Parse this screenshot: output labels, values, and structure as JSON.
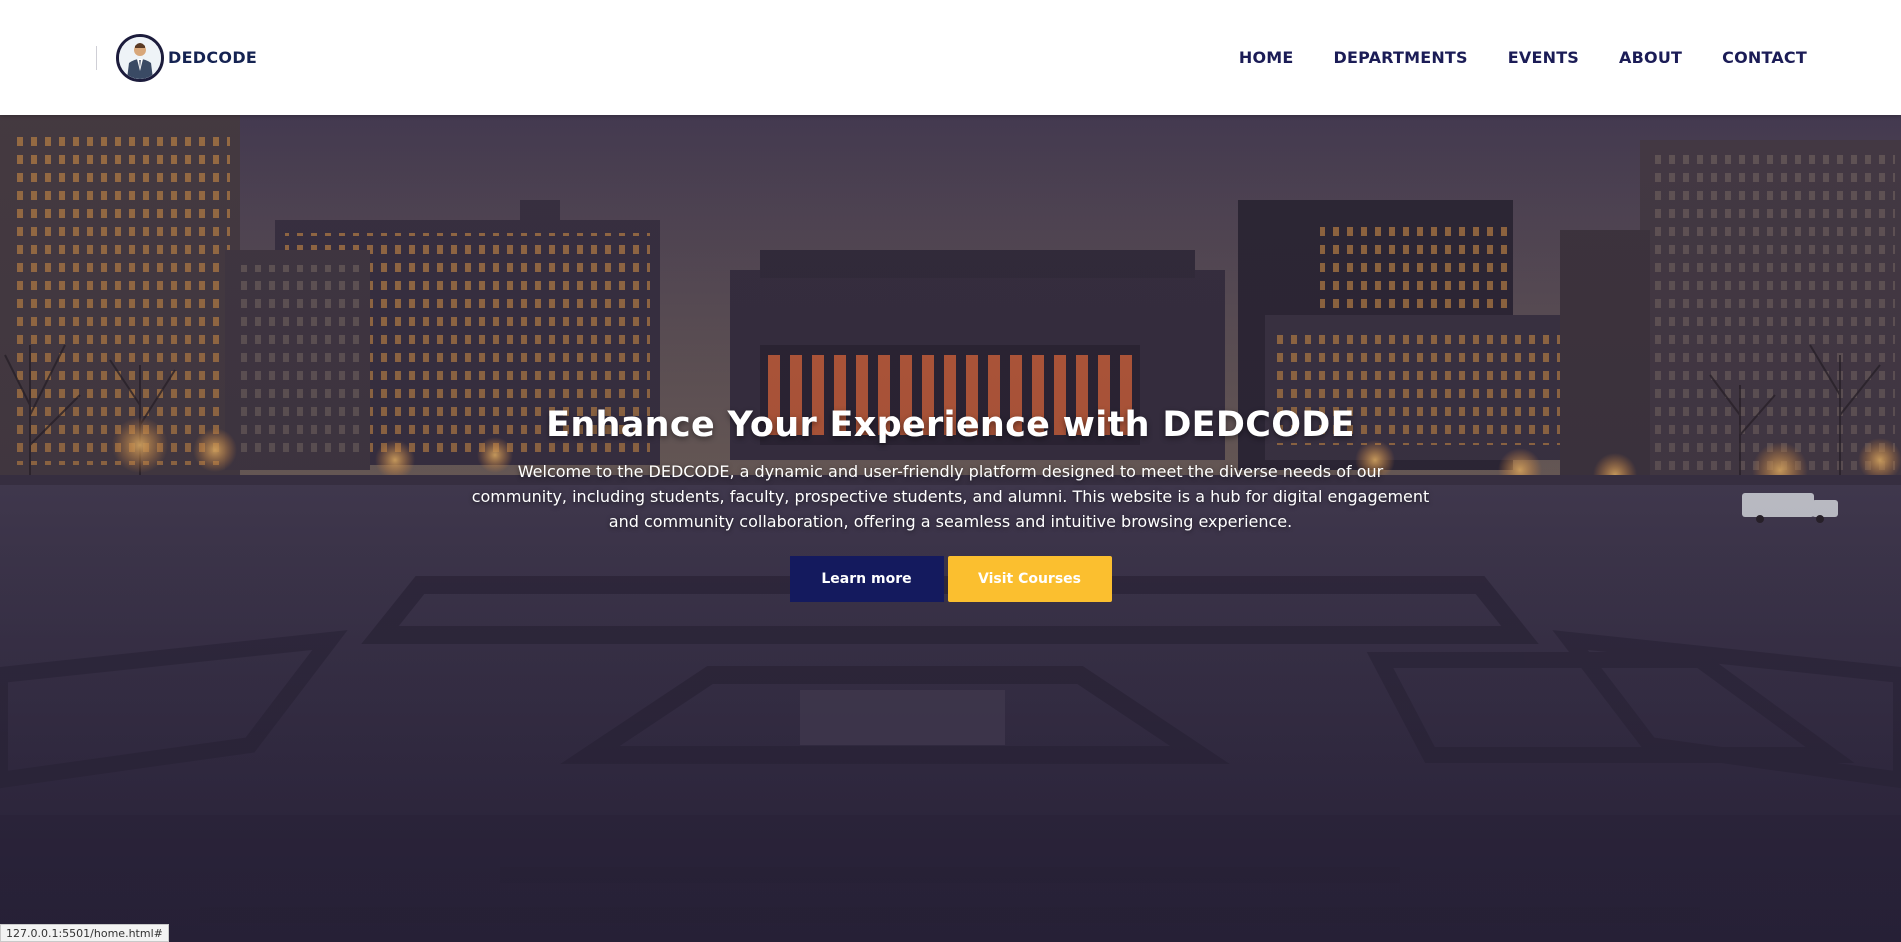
{
  "header": {
    "brand_name": "DEDCODE",
    "nav": [
      "HOME",
      "DEPARTMENTS",
      "EVENTS",
      "ABOUT",
      "CONTACT"
    ]
  },
  "hero": {
    "title": "Enhance Your Experience with DEDCODE",
    "text": "Welcome to the DEDCODE, a dynamic and user-friendly platform designed to meet the diverse needs of our community, including students, faculty, prospective students, and alumni. This website is a hub for digital engagement and community collaboration, offering a seamless and intuitive browsing experience.",
    "primary_button": "Learn more",
    "secondary_button": "Visit Courses"
  },
  "status_bar": {
    "url": "127.0.0.1:5501/home.html#"
  },
  "colors": {
    "brand": "#152352",
    "nav": "#1b1c56",
    "primary_button": "#141a5e",
    "secondary_button": "#fbbf2f"
  },
  "icons": [
    "logo-avatar"
  ]
}
